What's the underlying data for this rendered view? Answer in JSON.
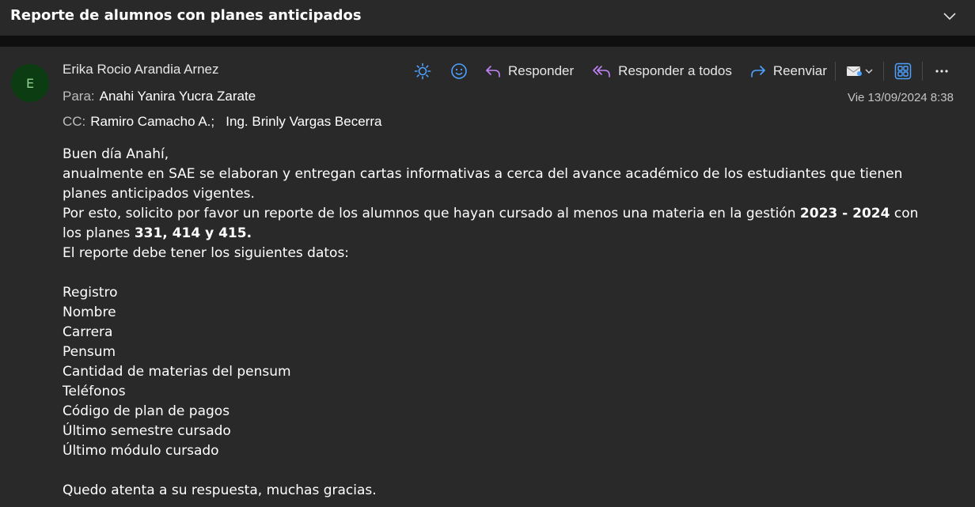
{
  "subject": "Reporte de alumnos con planes anticipados",
  "sender": {
    "avatar_initial": "E",
    "name": "Erika Rocio Arandia Arnez"
  },
  "to": {
    "label": "Para:",
    "recipients": "Anahi Yanira Yucra Zarate"
  },
  "cc": {
    "label": "CC:",
    "recipients": "Ramiro Camacho A.;   Ing. Brinly Vargas Becerra"
  },
  "date": "Vie 13/09/2024 8:38",
  "toolbar": {
    "reply_label": "Responder",
    "reply_all_label": "Responder a todos",
    "forward_label": "Reenviar"
  },
  "body": {
    "greeting": "Buen día Anahí,",
    "line1": "anualmente en SAE se elaboran y entregan cartas informativas a cerca del avance académico de los estudiantes que tienen planes anticipados vigentes.",
    "line2_pre": "Por esto, solicito por favor un reporte de los alumnos que hayan cursado al menos una materia en la gestión ",
    "line2_bold1": "2023 - 2024",
    "line2_mid": " con los planes ",
    "line2_bold2": "331, 414 y 415.",
    "line3": "El reporte debe tener los siguientes datos:",
    "fields": [
      "Registro",
      "Nombre",
      "Carrera",
      "Pensum",
      "Cantidad de materias del pensum",
      "Teléfonos",
      "Código de plan de pagos",
      "Último semestre cursado",
      "Último módulo cursado"
    ],
    "closing": "Quedo atenta a su respuesta, muchas gracias."
  },
  "colors": {
    "accent_blue": "#4ea1ff",
    "accent_purple": "#c084fc",
    "avatar_bg": "#0c3d12"
  }
}
